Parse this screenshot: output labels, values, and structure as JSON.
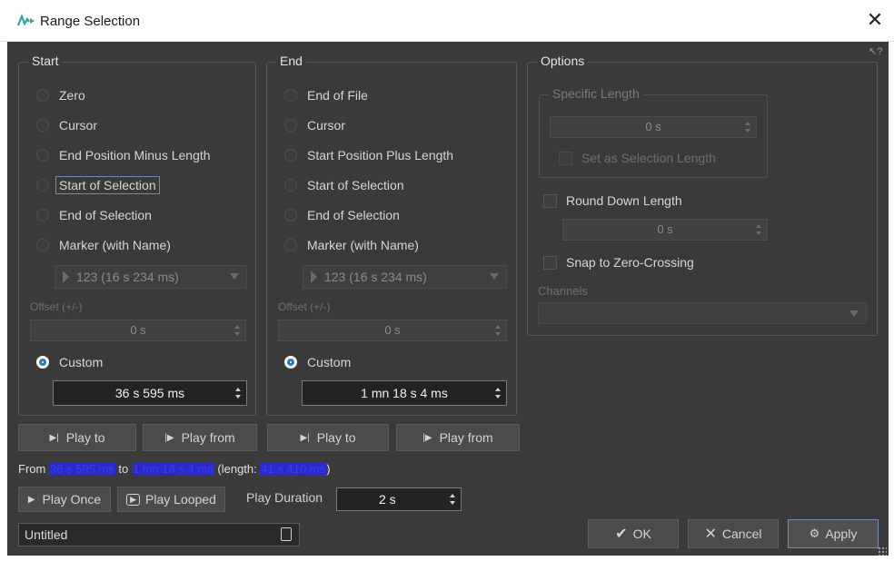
{
  "window": {
    "title": "Range Selection",
    "close_label": "✕",
    "help_label": "?"
  },
  "start": {
    "title": "Start",
    "options": [
      "Zero",
      "Cursor",
      "End Position Minus Length",
      "Start of Selection",
      "End of Selection",
      "Marker (with Name)",
      "Custom"
    ],
    "selected": "Custom",
    "marker_value": "123 (16 s 234 ms)",
    "offset_label": "Offset (+/-)",
    "offset_value": "0 s",
    "custom_value": "36 s 595 ms"
  },
  "end": {
    "title": "End",
    "options": [
      "End of File",
      "Cursor",
      "Start Position Plus Length",
      "Start of Selection",
      "End of Selection",
      "Marker (with Name)",
      "Custom"
    ],
    "selected": "Custom",
    "marker_value": "123 (16 s 234 ms)",
    "offset_label": "Offset (+/-)",
    "offset_value": "0 s",
    "custom_value": "1 mn 18 s 4 ms"
  },
  "options": {
    "title": "Options",
    "specific_length": {
      "title": "Specific Length",
      "value": "0 s",
      "set_as_selection_label": "Set as Selection Length"
    },
    "round_down": {
      "label": "Round Down Length",
      "value": "0 s"
    },
    "snap_label": "Snap to Zero-Crossing",
    "channels_label": "Channels",
    "channels_value": ""
  },
  "play_buttons": {
    "play_to": "Play to",
    "play_from": "Play from"
  },
  "info": {
    "from_label": "From",
    "from_value": "36 s 595 ms",
    "to_label": "to",
    "to_value": "1 mn 18 s 4 ms",
    "length_label": "(length:",
    "length_value": "41 s 410 ms",
    "close_paren": ")"
  },
  "playback": {
    "play_once": "Play Once",
    "play_looped": "Play Looped",
    "duration_label": "Play Duration",
    "duration_value": "2 s"
  },
  "name_field": {
    "value": "Untitled"
  },
  "footer": {
    "ok": "OK",
    "cancel": "Cancel",
    "apply": "Apply"
  },
  "colors": {
    "background": "#3a3a3a",
    "accent": "#2f6fc7",
    "highlight_text": "#2a2ac8"
  }
}
